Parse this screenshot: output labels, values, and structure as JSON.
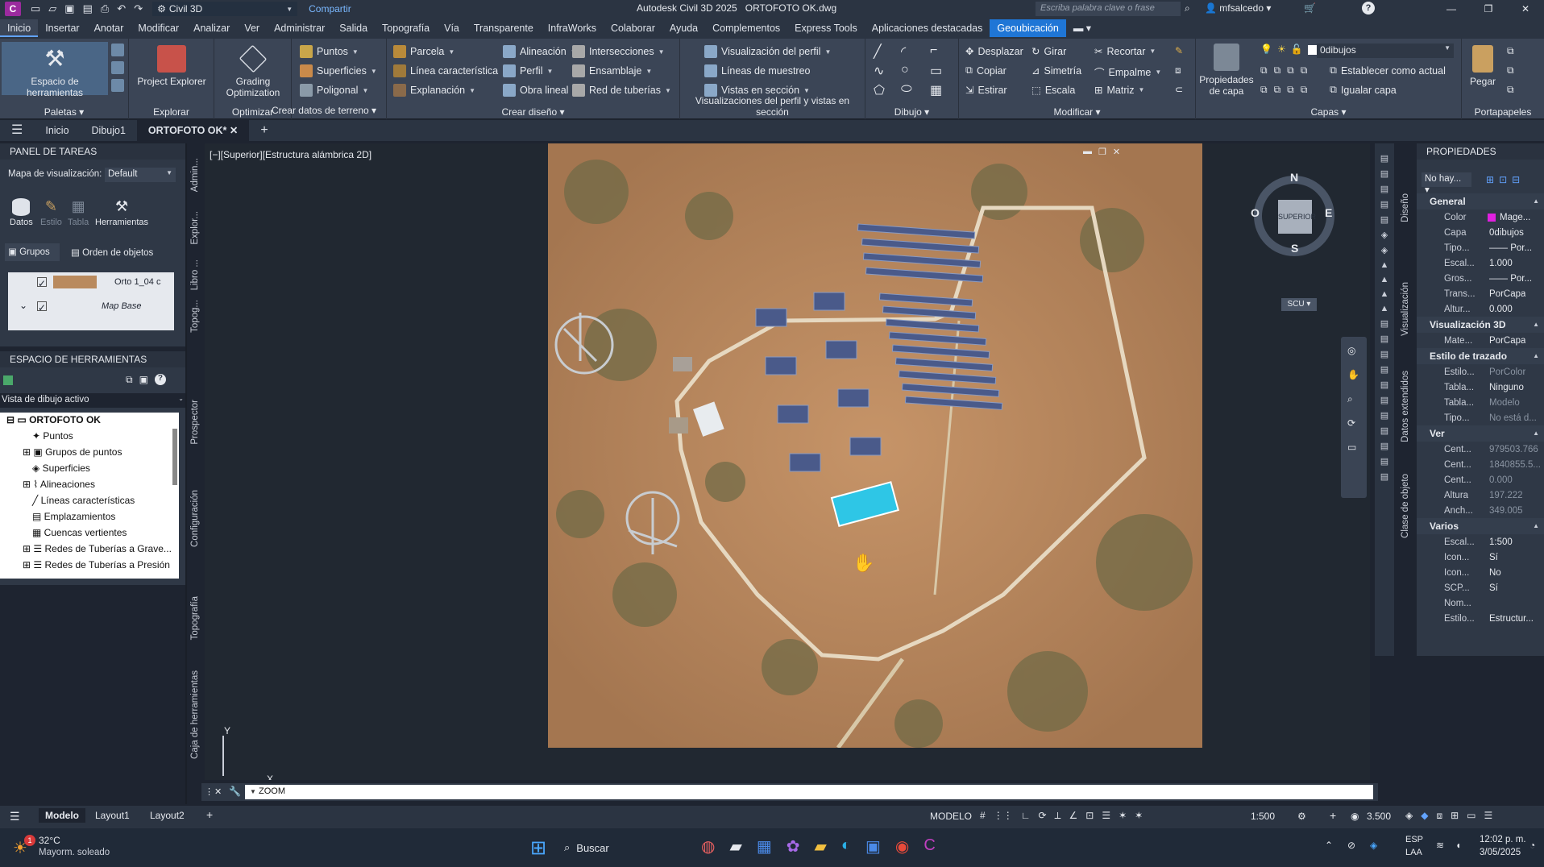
{
  "app": {
    "app_icon": "C",
    "workspace": "Civil 3D",
    "share": "Compartir",
    "title": "Autodesk Civil 3D 2025",
    "filename": "ORTOFOTO OK.dwg",
    "search_placeholder": "Escriba palabra clave o frase",
    "user": "mfsalcedo"
  },
  "ribbon_tabs": [
    "Inicio",
    "Insertar",
    "Anotar",
    "Modificar",
    "Analizar",
    "Ver",
    "Administrar",
    "Salida",
    "Topografía",
    "Vía",
    "Transparente",
    "InfraWorks",
    "Colaborar",
    "Ayuda",
    "Complementos",
    "Express Tools",
    "Aplicaciones destacadas",
    "Geoubicación"
  ],
  "ribbon": {
    "paletas": {
      "big": "Espacio de herramientas",
      "title": "Paletas"
    },
    "explorar": {
      "big": "Project Explorer",
      "title": "Explorar"
    },
    "optimizar": {
      "big": "Grading Optimization",
      "title": "Optimizar"
    },
    "terreno": {
      "items": [
        "Puntos",
        "Superficies",
        "Poligonal"
      ],
      "title": "Crear datos de terreno"
    },
    "diseno": {
      "col1": [
        "Parcela",
        "Línea característica",
        "Explanación"
      ],
      "col2": [
        "Alineación",
        "Perfil",
        "Obra lineal"
      ],
      "col3": [
        "Intersecciones",
        "Ensamblaje",
        "Red de tuberías"
      ],
      "title": "Crear diseño"
    },
    "perfil": {
      "items": [
        "Visualización del perfil",
        "Líneas de muestreo",
        "Vistas en sección"
      ],
      "title": "Visualizaciones del perfil y vistas en sección"
    },
    "dibujo": {
      "title": "Dibujo"
    },
    "modificar": {
      "col1": [
        "Desplazar",
        "Copiar",
        "Estirar"
      ],
      "col2": [
        "Girar",
        "Simetría",
        "Escala"
      ],
      "col3": [
        "Recortar",
        "Empalme",
        "Matriz"
      ],
      "title": "Modificar"
    },
    "capas": {
      "big": "Propiedades de capa",
      "layer": "0dibujos",
      "items": [
        "Establecer como actual",
        "Igualar capa"
      ],
      "title": "Capas"
    },
    "portapapeles": {
      "big": "Pegar",
      "title": "Portapapeles"
    }
  },
  "file_tabs": [
    "Inicio",
    "Dibujo1",
    "ORTOFOTO OK*"
  ],
  "task_panel": {
    "title": "PANEL DE TAREAS",
    "map_label": "Mapa de visualización:",
    "map_value": "Default",
    "tools": [
      "Datos",
      "Estilo",
      "Tabla",
      "Herramientas"
    ],
    "tabs": [
      "Grupos",
      "Orden de objetos"
    ],
    "layers": [
      "Orto 1_04 c",
      "Map Base"
    ],
    "side_tabs": [
      "Admin...",
      "Explor...",
      "Libro ...",
      "Topog..."
    ]
  },
  "tool_panel": {
    "title": "ESPACIO DE HERRAMIENTAS",
    "view": "Vista de dibujo activo",
    "root": "ORTOFOTO OK",
    "items": [
      "Puntos",
      "Grupos de puntos",
      "Superficies",
      "Alineaciones",
      "Líneas características",
      "Emplazamientos",
      "Cuencas vertientes",
      "Redes de Tuberías a Grave...",
      "Redes de Tuberías a Presión"
    ],
    "side_tabs": [
      "Prospector",
      "Configuración",
      "Topografía",
      "Caja de herramientas"
    ]
  },
  "viewport": {
    "label": "[−][Superior][Estructura alámbrica 2D]",
    "viewcube": {
      "face": "SUPERIOR",
      "n": "N",
      "s": "S",
      "e": "E",
      "w": "O",
      "ucs": "SCU"
    },
    "axis_y": "Y",
    "axis_x": "X"
  },
  "properties": {
    "title": "PROPIEDADES",
    "selection": "No hay...",
    "sections": [
      {
        "name": "General",
        "rows": [
          [
            "Color",
            "Mage..."
          ],
          [
            "Capa",
            "0dibujos"
          ],
          [
            "Tipo...",
            "—— Por..."
          ],
          [
            "Escal...",
            "1.000"
          ],
          [
            "Gros...",
            "—— Por..."
          ],
          [
            "Trans...",
            "PorCapa"
          ],
          [
            "Altur...",
            "0.000"
          ]
        ]
      },
      {
        "name": "Visualización 3D",
        "rows": [
          [
            "Mate...",
            "PorCapa"
          ]
        ]
      },
      {
        "name": "Estilo de trazado",
        "rows": [
          [
            "Estilo...",
            "PorColor"
          ],
          [
            "Tabla...",
            "Ninguno"
          ],
          [
            "Tabla...",
            "Modelo"
          ],
          [
            "Tipo...",
            "No está d..."
          ]
        ]
      },
      {
        "name": "Ver",
        "rows": [
          [
            "Cent...",
            "979503.766"
          ],
          [
            "Cent...",
            "1840855.5..."
          ],
          [
            "Cent...",
            "0.000"
          ],
          [
            "Altura",
            "197.222"
          ],
          [
            "Anch...",
            "349.005"
          ]
        ]
      },
      {
        "name": "Varios",
        "rows": [
          [
            "Escal...",
            "1:500"
          ],
          [
            "Icon...",
            "Sí"
          ],
          [
            "Icon...",
            "No"
          ],
          [
            "SCP...",
            "Sí"
          ],
          [
            "Nom...",
            ""
          ],
          [
            "Estilo...",
            "Estructur..."
          ]
        ]
      }
    ],
    "side_tabs": [
      "Diseño",
      "Visualización",
      "Datos extendidos",
      "Clase de objeto"
    ],
    "magenta": "#e020e0"
  },
  "command": {
    "text": "ZOOM"
  },
  "status": {
    "tabs": [
      "Modelo",
      "Layout1",
      "Layout2"
    ],
    "mode": "MODELO",
    "scale": "1:500",
    "value": "3.500"
  },
  "taskbar": {
    "weather_temp": "32°C",
    "weather_desc": "Mayorm. soleado",
    "badge": "1",
    "search": "Buscar",
    "lang1": "ESP",
    "lang2": "LAA",
    "time": "12:02 p. m.",
    "date": "3/05/2025"
  }
}
